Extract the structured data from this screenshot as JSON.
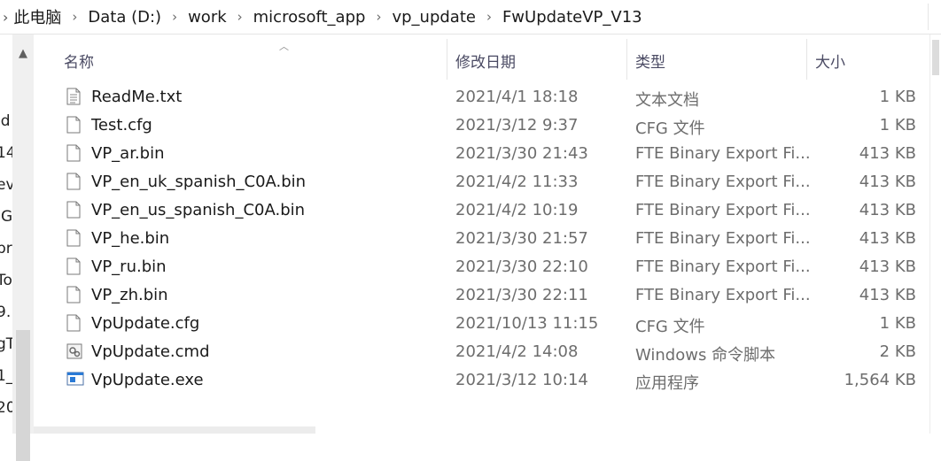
{
  "address": {
    "segments": [
      "此电脑",
      "Data (D:)",
      "work",
      "microsoft_app",
      "vp_update",
      "FwUpdateVP_V13"
    ]
  },
  "nav_fragments": [
    "ld",
    "14",
    "ev",
    "JG",
    "pr",
    "To",
    "9.",
    "gT",
    "1_",
    "20"
  ],
  "columns": {
    "name": "名称",
    "date": "修改日期",
    "type": "类型",
    "size": "大小"
  },
  "files": [
    {
      "name": "ReadMe.txt",
      "date": "2021/4/1 18:18",
      "type": "文本文档",
      "size": "1 KB",
      "icon": "text-file-icon"
    },
    {
      "name": "Test.cfg",
      "date": "2021/3/12 9:37",
      "type": "CFG 文件",
      "size": "1 KB",
      "icon": "file-icon"
    },
    {
      "name": "VP_ar.bin",
      "date": "2021/3/30 21:43",
      "type": "FTE Binary Export Fi...",
      "size": "413 KB",
      "icon": "file-icon"
    },
    {
      "name": "VP_en_uk_spanish_C0A.bin",
      "date": "2021/4/2 11:33",
      "type": "FTE Binary Export Fi...",
      "size": "413 KB",
      "icon": "file-icon"
    },
    {
      "name": "VP_en_us_spanish_C0A.bin",
      "date": "2021/4/2 10:19",
      "type": "FTE Binary Export Fi...",
      "size": "413 KB",
      "icon": "file-icon"
    },
    {
      "name": "VP_he.bin",
      "date": "2021/3/30 21:57",
      "type": "FTE Binary Export Fi...",
      "size": "413 KB",
      "icon": "file-icon"
    },
    {
      "name": "VP_ru.bin",
      "date": "2021/3/30 22:10",
      "type": "FTE Binary Export Fi...",
      "size": "413 KB",
      "icon": "file-icon"
    },
    {
      "name": "VP_zh.bin",
      "date": "2021/3/30 22:11",
      "type": "FTE Binary Export Fi...",
      "size": "413 KB",
      "icon": "file-icon"
    },
    {
      "name": "VpUpdate.cfg",
      "date": "2021/10/13 11:15",
      "type": "CFG 文件",
      "size": "1 KB",
      "icon": "file-icon"
    },
    {
      "name": "VpUpdate.cmd",
      "date": "2021/4/2 14:08",
      "type": "Windows 命令脚本",
      "size": "2 KB",
      "icon": "script-file-icon"
    },
    {
      "name": "VpUpdate.exe",
      "date": "2021/3/12 10:14",
      "type": "应用程序",
      "size": "1,564 KB",
      "icon": "exe-file-icon"
    }
  ]
}
